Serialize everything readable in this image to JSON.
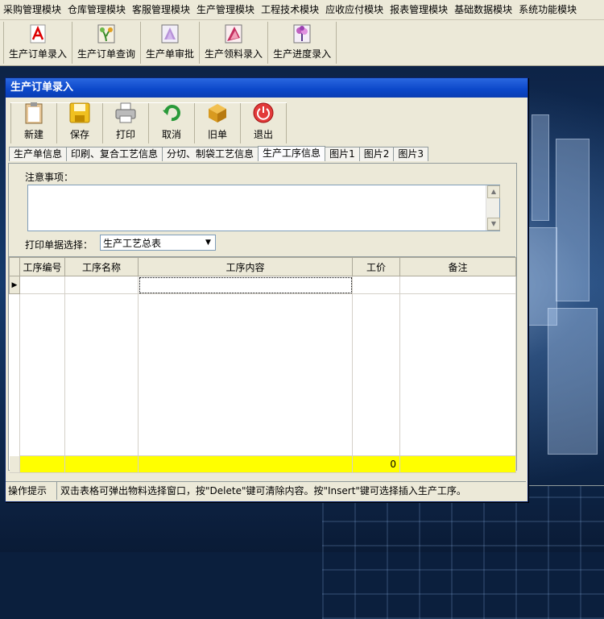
{
  "menu": [
    "采购管理模块",
    "仓库管理模块",
    "客服管理模块",
    "生产管理模块",
    "工程技术模块",
    "应收应付模块",
    "报表管理模块",
    "基础数据模块",
    "系统功能模块"
  ],
  "toolbar": {
    "buttons": [
      {
        "label": "生产订单录入",
        "icon": "pdf-icon"
      },
      {
        "label": "生产订单查询",
        "icon": "plant-icon"
      },
      {
        "label": "生产单审批",
        "icon": "flower-icon"
      },
      {
        "label": "生产领料录入",
        "icon": "ribbon-icon"
      },
      {
        "label": "生产进度录入",
        "icon": "flower2-icon"
      }
    ]
  },
  "window": {
    "title": "生产订单录入",
    "toolbar": [
      {
        "label": "新建",
        "icon": "clipboard-icon"
      },
      {
        "label": "保存",
        "icon": "save-icon"
      },
      {
        "label": "打印",
        "icon": "printer-icon"
      },
      {
        "label": "取消",
        "icon": "refresh-icon"
      },
      {
        "label": "旧单",
        "icon": "box-icon"
      },
      {
        "label": "退出",
        "icon": "power-icon"
      }
    ],
    "tabs": [
      "生产单信息",
      "印刷、复合工艺信息",
      "分切、制袋工艺信息",
      "生产工序信息",
      "图片1",
      "图片2",
      "图片3"
    ],
    "active_tab": 3,
    "notice_label": "注意事项：",
    "print_label": "打印单据选择：",
    "print_select_value": "生产工艺总表",
    "columns": [
      "工序编号",
      "工序名称",
      "工序内容",
      "工价",
      "备注"
    ],
    "total_price": "0",
    "status_label": "操作提示",
    "status_text": "双击表格可弹出物料选择窗口，按\"Delete\"键可清除内容。按\"Insert\"键可选择插入生产工序。"
  },
  "colors": {
    "title_bar": "#0b47c9",
    "total_row": "#ffff00",
    "chrome": "#ece9d8"
  }
}
